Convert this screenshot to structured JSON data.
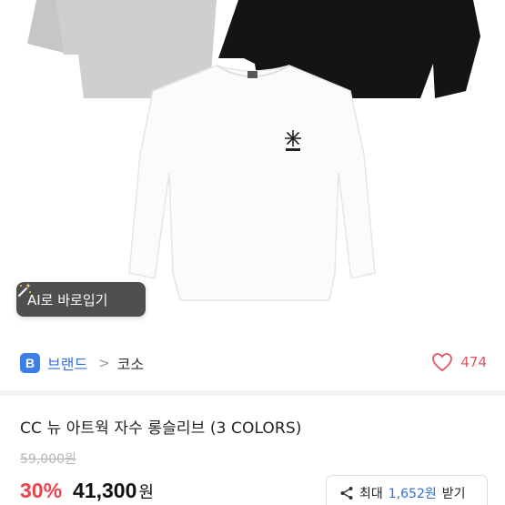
{
  "ai_button": {
    "label": "AI로 바로입기",
    "icon": "magic-wand-icon"
  },
  "brand": {
    "badge": "B",
    "label": "브랜드",
    "separator": ">",
    "name": "코소"
  },
  "like": {
    "icon": "heart-outline-icon",
    "count": "474",
    "color": "#e25563"
  },
  "product": {
    "title": "CC 뉴 아트웍 자수 롱슬리브 (3 COLORS)",
    "original_price": "59,000원",
    "discount": "30%",
    "price_number": "41,300",
    "price_unit": "원"
  },
  "coupon": {
    "icon": "share-icon",
    "prefix": "최대",
    "amount": "1,652원",
    "suffix": "받기"
  },
  "colors": {
    "brand_blue": "#2f6fe0",
    "discount_red": "#f0424e",
    "shirt_gray": "#cfcfcf",
    "shirt_black": "#141414",
    "shirt_white": "#fafafa"
  }
}
